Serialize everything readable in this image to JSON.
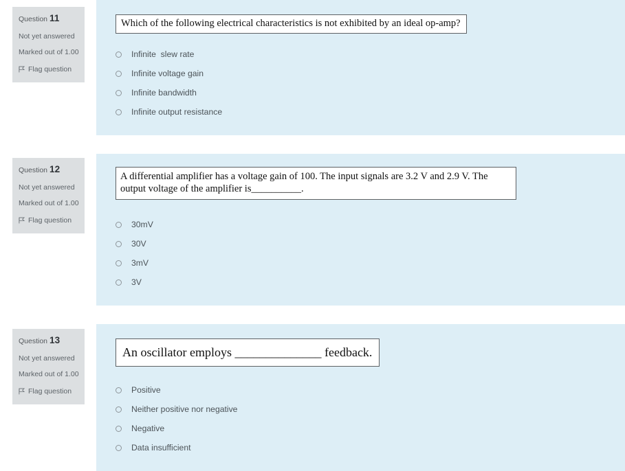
{
  "theme": {
    "panel_bg": "#ddeef6",
    "info_bg": "#dcdfe1",
    "page_bg": "#ffffff",
    "stem_border": "#5d6063",
    "option_text": "#4c5358",
    "info_text": "#5d6368"
  },
  "questions": [
    {
      "number_label": "Question",
      "number": "11",
      "status": "Not yet answered",
      "marks": "Marked out of 1.00",
      "flag_label": "Flag question",
      "flag_icon": "flag-icon",
      "stem": "Which of the following electrical characteristics is not exhibited by an ideal op-amp?",
      "options": [
        "Infinite  slew rate",
        "Infinite voltage gain",
        "Infinite bandwidth",
        "Infinite output resistance"
      ],
      "selected": null
    },
    {
      "number_label": "Question",
      "number": "12",
      "status": "Not yet answered",
      "marks": "Marked out of 1.00",
      "flag_label": "Flag question",
      "flag_icon": "flag-icon",
      "stem": "A differential amplifier has a voltage gain of 100. The input signals are 3.2 V and 2.9 V. The output voltage of the amplifier is__________.",
      "options": [
        "30mV",
        "30V",
        "3mV",
        "3V"
      ],
      "selected": null
    },
    {
      "number_label": "Question",
      "number": "13",
      "status": "Not yet answered",
      "marks": "Marked out of 1.00",
      "flag_label": "Flag question",
      "flag_icon": "flag-icon",
      "stem": "An oscillator employs ______________ feedback.",
      "options": [
        "Positive",
        "Neither positive nor negative",
        "Negative",
        "Data insufficient"
      ],
      "selected": null
    }
  ]
}
